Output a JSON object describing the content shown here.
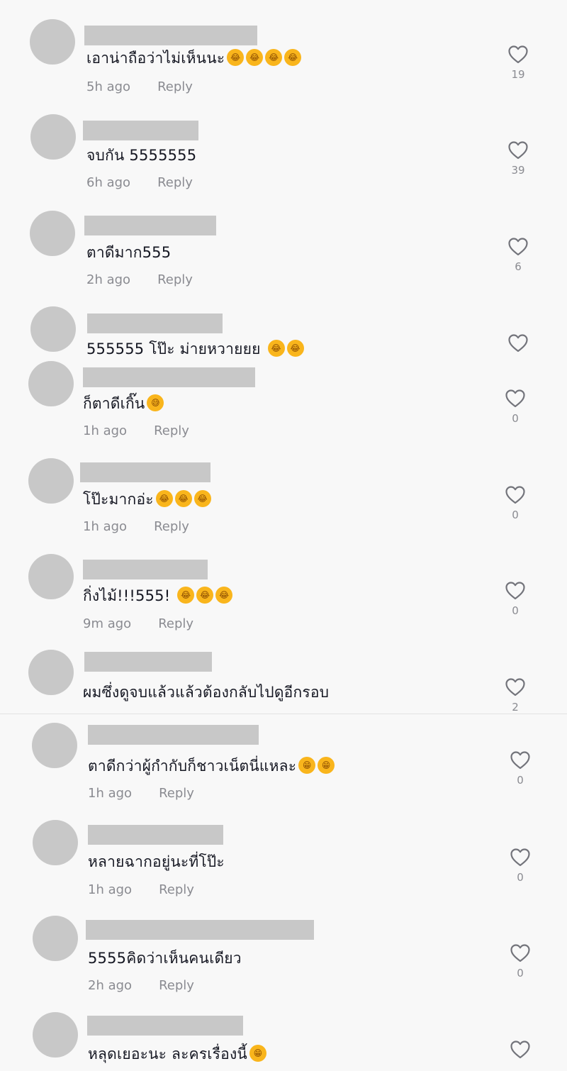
{
  "comments": [
    {
      "text": "เอาน่าถือว่าไม่เห็นนะ",
      "emoji": [
        "😂",
        "😂",
        "😂",
        "😂"
      ],
      "time": "5h ago",
      "reply": "Reply",
      "likes": "19"
    },
    {
      "text": "จบกัน 5555555",
      "emoji": [],
      "time": "6h ago",
      "reply": "Reply",
      "likes": "39"
    },
    {
      "text": "ตาดีมาก555",
      "emoji": [],
      "time": "2h ago",
      "reply": "Reply",
      "likes": "6"
    },
    {
      "text": "555555 โป๊ะ ม่ายหวายยย ",
      "emoji": [
        "😂",
        "😂"
      ],
      "time": "",
      "reply": "",
      "likes": ""
    },
    {
      "text": "ก็ตาดีเกิ๊น",
      "emoji": [
        "😅"
      ],
      "time": "1h ago",
      "reply": "Reply",
      "likes": "0"
    },
    {
      "text": "โป๊ะมากอ่ะ",
      "emoji": [
        "😂",
        "😂",
        "😂"
      ],
      "time": "1h ago",
      "reply": "Reply",
      "likes": "0"
    },
    {
      "text": "กิ่งไม้!!!555! ",
      "emoji": [
        "😂",
        "😂",
        "😂"
      ],
      "time": "9m ago",
      "reply": "Reply",
      "likes": "0"
    },
    {
      "text": "ผมซึ่งดูจบแล้วแล้วต้องกลับไปดูอีกรอบ",
      "emoji": [],
      "time": "",
      "reply": "",
      "likes": "2"
    },
    {
      "text": "ตาดีกว่าผู้กำกับก็ชาวเน็ตนี่แหละ",
      "emoji": [
        "😁",
        "😁"
      ],
      "time": "1h ago",
      "reply": "Reply",
      "likes": "0"
    },
    {
      "text": "หลายฉากอยู่นะที่โป๊ะ",
      "emoji": [],
      "time": "1h ago",
      "reply": "Reply",
      "likes": "0"
    },
    {
      "text": "5555คิดว่าเห็นคนเดียว",
      "emoji": [],
      "time": "2h ago",
      "reply": "Reply",
      "likes": "0"
    },
    {
      "text": "หลุดเยอะนะ ละครเรื่องนี้",
      "emoji": [
        "😁"
      ],
      "time": "",
      "reply": "",
      "likes": ""
    }
  ],
  "icons": {
    "like": "heart-outline-icon",
    "avatar": "avatar-placeholder",
    "username": "redacted-username-bar"
  },
  "colors": {
    "placeholder": "#c8c8c8",
    "meta": "#8a8b91",
    "text": "#161823",
    "background": "#f8f8f8"
  }
}
